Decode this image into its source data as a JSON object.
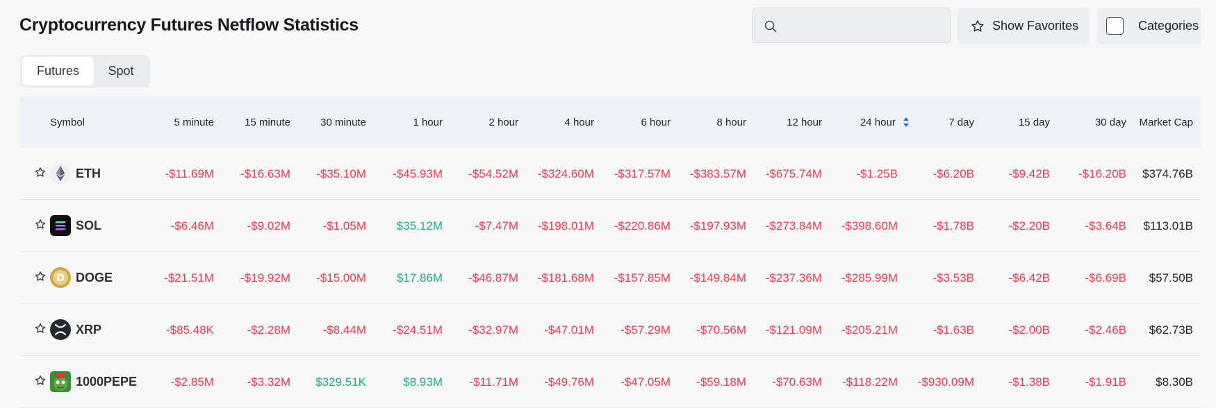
{
  "page": {
    "title": "Cryptocurrency Futures Netflow Statistics"
  },
  "search": {
    "placeholder": "",
    "value": ""
  },
  "toolbar": {
    "show_favorites_label": "Show Favorites",
    "categories_label": "Categories"
  },
  "tabs": [
    {
      "label": "Futures",
      "active": true
    },
    {
      "label": "Spot",
      "active": false
    }
  ],
  "table": {
    "columns": [
      "Symbol",
      "5 minute",
      "15 minute",
      "30 minute",
      "1 hour",
      "2 hour",
      "4 hour",
      "6 hour",
      "8 hour",
      "12 hour",
      "24 hour",
      "7 day",
      "15 day",
      "30 day",
      "Market Cap"
    ],
    "sorted_column": "24 hour",
    "rows": [
      {
        "symbol": "ETH",
        "icon": "eth-icon",
        "values": [
          "-$11.69M",
          "-$16.63M",
          "-$35.10M",
          "-$45.93M",
          "-$54.52M",
          "-$324.60M",
          "-$317.57M",
          "-$383.57M",
          "-$675.74M",
          "-$1.25B",
          "-$6.20B",
          "-$9.42B",
          "-$16.20B"
        ],
        "market_cap": "$374.76B"
      },
      {
        "symbol": "SOL",
        "icon": "sol-icon",
        "values": [
          "-$6.46M",
          "-$9.02M",
          "-$1.05M",
          "$35.12M",
          "-$7.47M",
          "-$198.01M",
          "-$220.86M",
          "-$197.93M",
          "-$273.84M",
          "-$398.60M",
          "-$1.78B",
          "-$2.20B",
          "-$3.64B"
        ],
        "market_cap": "$113.01B"
      },
      {
        "symbol": "DOGE",
        "icon": "doge-icon",
        "values": [
          "-$21.51M",
          "-$19.92M",
          "-$15.00M",
          "$17.86M",
          "-$46.87M",
          "-$181.68M",
          "-$157.85M",
          "-$149.84M",
          "-$237.36M",
          "-$285.99M",
          "-$3.53B",
          "-$6.42B",
          "-$6.69B"
        ],
        "market_cap": "$57.50B"
      },
      {
        "symbol": "XRP",
        "icon": "xrp-icon",
        "values": [
          "-$85.48K",
          "-$2.28M",
          "-$8.44M",
          "-$24.51M",
          "-$32.97M",
          "-$47.01M",
          "-$57.29M",
          "-$70.56M",
          "-$121.09M",
          "-$205.21M",
          "-$1.63B",
          "-$2.00B",
          "-$2.46B"
        ],
        "market_cap": "$62.73B"
      },
      {
        "symbol": "1000PEPE",
        "icon": "pepe-icon",
        "values": [
          "-$2.85M",
          "-$3.32M",
          "$329.51K",
          "$8.93M",
          "-$11.71M",
          "-$49.76M",
          "-$47.05M",
          "-$59.18M",
          "-$70.63M",
          "-$118.22M",
          "-$930.09M",
          "-$1.38B",
          "-$1.91B"
        ],
        "market_cap": "$8.30B"
      }
    ]
  },
  "colors": {
    "negative": "#f0394f",
    "positive": "#1fa88a",
    "sort_accent": "#2f6fd6"
  }
}
